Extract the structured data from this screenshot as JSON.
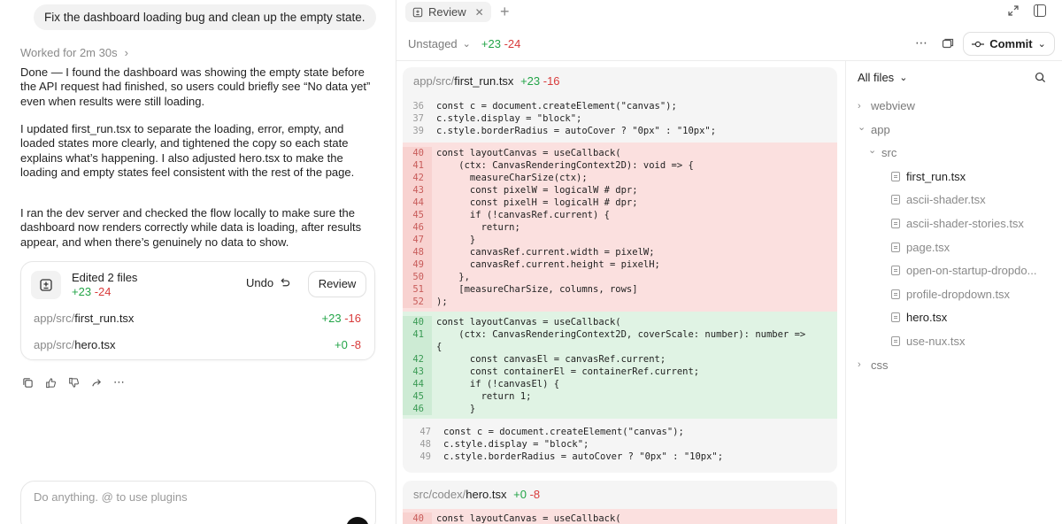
{
  "chat": {
    "user_message": "Fix the dashboard loading bug and clean up the empty state.",
    "worked_for": "Worked for 2m 30s",
    "paragraphs": [
      "Done — I found the dashboard was showing the empty state before the API request had finished, so users could briefly see “No data yet” even when results were still loading.",
      "I updated first_run.tsx to separate the loading, error, empty, and loaded states more clearly, and tightened the copy so each state explains what’s happening. I also adjusted hero.tsx to make the loading and empty states feel consistent with the rest of the page.",
      "I ran the dev server and checked the flow locally to make sure the dashboard now renders correctly while data is loading, after results appear, and when there’s genuinely no data to show."
    ],
    "edits_card": {
      "title": "Edited 2 files",
      "plus": "+23",
      "minus": "-24",
      "undo_label": "Undo",
      "review_label": "Review",
      "files": [
        {
          "dir": "app/src/",
          "name": "first_run.tsx",
          "plus": "+23",
          "minus": "-16"
        },
        {
          "dir": "app/src/",
          "name": "hero.tsx",
          "plus": "+0",
          "minus": "-8"
        }
      ]
    },
    "composer_placeholder": "Do anything. @ to use plugins"
  },
  "review": {
    "tab_label": "Review",
    "unstaged_label": "Unstaged",
    "unstaged_plus": "+23",
    "unstaged_minus": "-24",
    "commit_label": "Commit",
    "diff_files": [
      {
        "dir": "app/src/",
        "name": "first_run.tsx",
        "plus": "+23",
        "minus": "-16",
        "context_top": [
          {
            "n": "36",
            "t": "const c = document.createElement(\"canvas\");"
          },
          {
            "n": "37",
            "t": "c.style.display = \"block\";"
          },
          {
            "n": "39",
            "t": "c.style.borderRadius = autoCover ? \"0px\" : \"10px\";"
          }
        ],
        "removed": [
          {
            "n": "40",
            "t": "const layoutCanvas = useCallback("
          },
          {
            "n": "41",
            "t": "    (ctx: CanvasRenderingContext2D): void => {"
          },
          {
            "n": "42",
            "t": "      measureCharSize(ctx);"
          },
          {
            "n": "43",
            "t": "      const pixelW = logicalW # dpr;"
          },
          {
            "n": "44",
            "t": "      const pixelH = logicalH # dpr;"
          },
          {
            "n": "45",
            "t": "      if (!canvasRef.current) {"
          },
          {
            "n": "46",
            "t": "        return;"
          },
          {
            "n": "47",
            "t": "      }"
          },
          {
            "n": "48",
            "t": "      canvasRef.current.width = pixelW;"
          },
          {
            "n": "49",
            "t": "      canvasRef.current.height = pixelH;"
          },
          {
            "n": "50",
            "t": "    },"
          },
          {
            "n": "51",
            "t": "    [measureCharSize, columns, rows]"
          },
          {
            "n": "52",
            "t": ");"
          }
        ],
        "added": [
          {
            "n": "40",
            "t": "const layoutCanvas = useCallback("
          },
          {
            "n": "41",
            "t": "    (ctx: CanvasRenderingContext2D, coverScale: number): number =>"
          },
          {
            "n": "",
            "t": "{"
          },
          {
            "n": "42",
            "t": "      const canvasEl = canvasRef.current;"
          },
          {
            "n": "43",
            "t": "      const containerEl = containerRef.current;"
          },
          {
            "n": "44",
            "t": "      if (!canvasEl) {"
          },
          {
            "n": "45",
            "t": "        return 1;"
          },
          {
            "n": "46",
            "t": "      }"
          }
        ],
        "context_bottom": [
          {
            "n": "47",
            "t": "const c = document.createElement(\"canvas\");"
          },
          {
            "n": "48",
            "t": "c.style.display = \"block\";"
          },
          {
            "n": "49",
            "t": "c.style.borderRadius = autoCover ? \"0px\" : \"10px\";"
          }
        ]
      },
      {
        "dir": "src/codex/",
        "name": "hero.tsx",
        "plus": "+0",
        "minus": "-8",
        "removed": [
          {
            "n": "40",
            "t": "const layoutCanvas = useCallback("
          }
        ]
      }
    ]
  },
  "tree": {
    "header": "All files",
    "items": [
      {
        "kind": "folder",
        "label": "webview",
        "open": false,
        "depth": 0
      },
      {
        "kind": "folder",
        "label": "app",
        "open": true,
        "depth": 0
      },
      {
        "kind": "folder",
        "label": "src",
        "open": true,
        "depth": 1
      },
      {
        "kind": "file",
        "label": "first_run.tsx",
        "active": true,
        "depth": 2
      },
      {
        "kind": "file",
        "label": "ascii-shader.tsx",
        "active": false,
        "depth": 2
      },
      {
        "kind": "file",
        "label": "ascii-shader-stories.tsx",
        "active": false,
        "depth": 2
      },
      {
        "kind": "file",
        "label": "page.tsx",
        "active": false,
        "depth": 2
      },
      {
        "kind": "file",
        "label": "open-on-startup-dropdo...",
        "active": false,
        "depth": 2
      },
      {
        "kind": "file",
        "label": "profile-dropdown.tsx",
        "active": false,
        "depth": 2
      },
      {
        "kind": "file",
        "label": "hero.tsx",
        "active": true,
        "depth": 2
      },
      {
        "kind": "file",
        "label": "use-nux.tsx",
        "active": false,
        "depth": 2
      },
      {
        "kind": "folder",
        "label": "css",
        "open": false,
        "depth": 0
      }
    ]
  },
  "colors": {
    "plus": "#22a447",
    "minus": "#d83a3a"
  },
  "icons": [
    "review-tab-icon",
    "close-icon",
    "plus-icon",
    "expand-icon",
    "sidebar-toggle-icon",
    "chevron-down-icon",
    "more-icon",
    "copy-icon",
    "commit-icon",
    "search-icon",
    "file-icon",
    "diff-icon",
    "undo-icon",
    "copy-action-icon",
    "thumbs-up-icon",
    "thumbs-down-icon",
    "share-icon"
  ]
}
